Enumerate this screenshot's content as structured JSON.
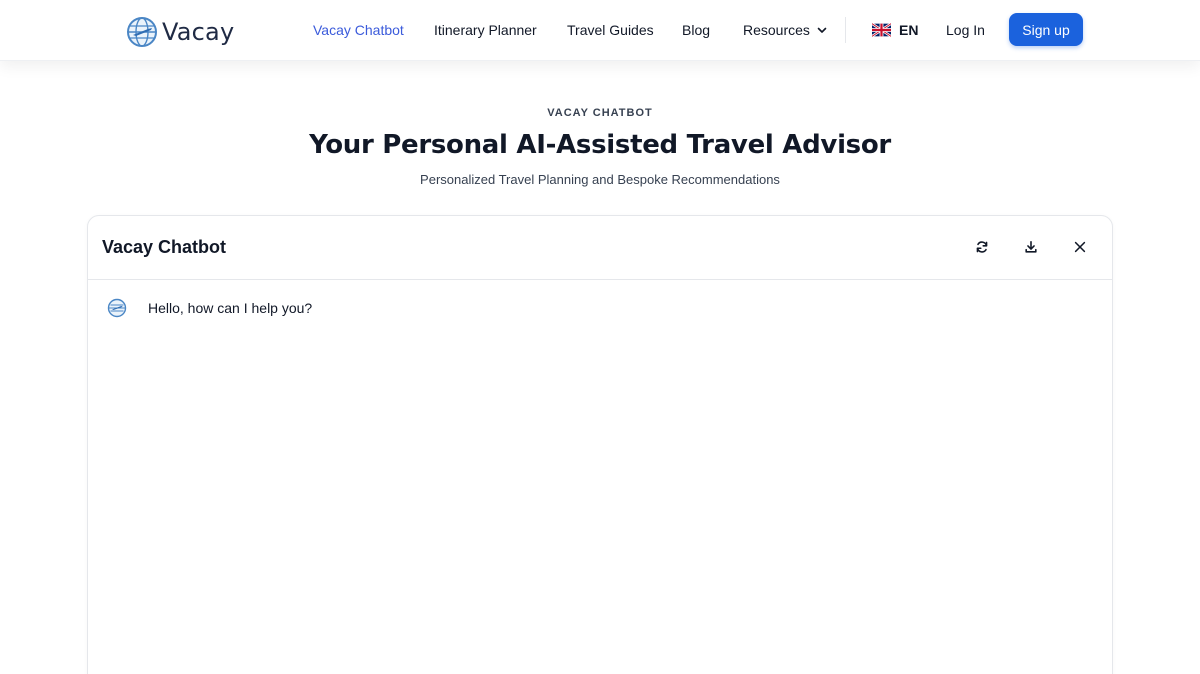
{
  "brand": {
    "name": "Vacay",
    "logo_icon": "globe-plane-icon",
    "accent": "#1b62dd"
  },
  "nav": {
    "items": [
      {
        "label": "Vacay Chatbot",
        "active": true
      },
      {
        "label": "Itinerary Planner"
      },
      {
        "label": "Travel Guides"
      },
      {
        "label": "Blog"
      },
      {
        "label": "Resources",
        "icon": "chevron-down-icon"
      }
    ],
    "language": {
      "code": "EN",
      "icon": "uk-flag-icon"
    },
    "login_label": "Log In",
    "signup_label": "Sign up"
  },
  "hero": {
    "eyebrow": "VACAY CHATBOT",
    "title": "Your Personal AI-Assisted Travel Advisor",
    "subtitle": "Personalized Travel Planning and Bespoke Recommendations"
  },
  "chat": {
    "title": "Vacay Chatbot",
    "actions": [
      "refresh-icon",
      "download-icon",
      "close-icon"
    ],
    "messages": [
      {
        "sender": "bot",
        "avatar": "bot-avatar-icon",
        "text": "Hello, how can I help you?"
      }
    ]
  }
}
